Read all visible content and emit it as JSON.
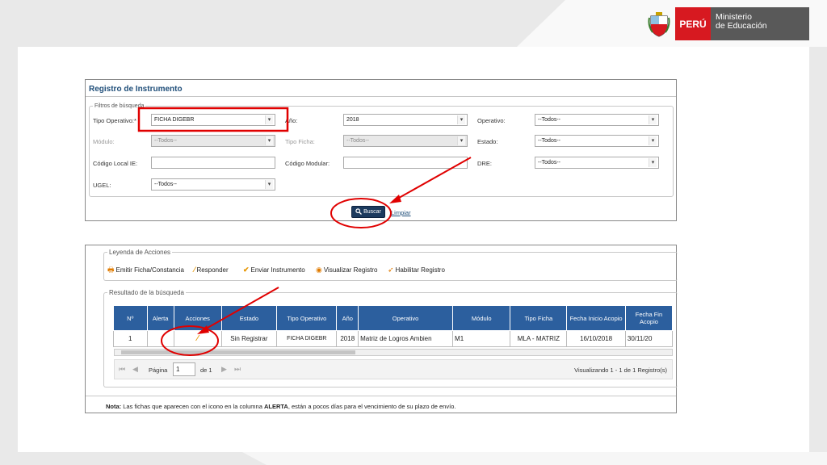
{
  "header": {
    "peru": "PERÚ",
    "ministerio_line1": "Ministerio",
    "ministerio_line2": "de Educación"
  },
  "registro": {
    "title": "Registro de Instrumento",
    "fieldset_legend": "Filtros de búsqueda",
    "fields": {
      "tipo_operativo": {
        "label": "Tipo Operativo:*",
        "value": "FICHA DIGEBR"
      },
      "anio": {
        "label": "Año:",
        "value": "2018"
      },
      "operativo": {
        "label": "Operativo:",
        "value": "--Todos--"
      },
      "modulo": {
        "label": "Módulo:",
        "value": "--Todos--"
      },
      "tipo_ficha": {
        "label": "Tipo Ficha:",
        "value": "--Todos--"
      },
      "estado": {
        "label": "Estado:",
        "value": "--Todos--"
      },
      "codigo_local": {
        "label": "Código Local IE:",
        "value": ""
      },
      "codigo_modular": {
        "label": "Código Modular:",
        "value": ""
      },
      "dre": {
        "label": "DRE:",
        "value": "--Todos--"
      },
      "ugel": {
        "label": "UGEL:",
        "value": "--Todos--"
      }
    },
    "buscar_label": "Buscar",
    "limpiar_label": "Limpiar"
  },
  "leyenda": {
    "legend": "Leyenda de Acciones",
    "items": [
      {
        "icon": "print-icon",
        "label": "Emitir Ficha/Constancia"
      },
      {
        "icon": "pencil-icon",
        "label": "Responder"
      },
      {
        "icon": "check-icon",
        "label": "Enviar Instrumento"
      },
      {
        "icon": "eye-icon",
        "label": "Visualizar Registro"
      },
      {
        "icon": "send-icon",
        "label": "Habilitar Registro"
      }
    ]
  },
  "resultado": {
    "legend": "Resultado de la búsqueda",
    "columns": [
      "Nº",
      "Alerta",
      "Acciones",
      "Estado",
      "Tipo Operativo",
      "Año",
      "Operativo",
      "Módulo",
      "Tipo Ficha",
      "Fecha Inicio Acopio",
      "Fecha Fin Acopio"
    ],
    "rows": [
      {
        "n": "1",
        "alerta": "",
        "acciones": "pencil-icon",
        "estado": "Sin Registrar",
        "tipo_operativo": "FICHA DIGEBR",
        "anio": "2018",
        "operativo": "Matriz de Logros Ambien",
        "modulo": "M1",
        "tipo_ficha": "MLA - MATRIZ",
        "fecha_inicio": "16/10/2018",
        "fecha_fin": "30/11/20"
      }
    ],
    "pager": {
      "pagina_label": "Página",
      "page": "1",
      "de_label": "de 1",
      "visualizando": "Visualizando 1 - 1 de 1 Registro(s)"
    }
  },
  "nota": {
    "prefix": "Nota:",
    "text1": " Las fichas que aparecen con el icono en la columna ",
    "bold": "ALERTA",
    "text2": ", están a pocos días para el vencimiento de su plazo de envío."
  },
  "colors": {
    "accent_red": "#d71920",
    "header_blue": "#2c5f9e",
    "button_navy": "#1c3a5e"
  }
}
